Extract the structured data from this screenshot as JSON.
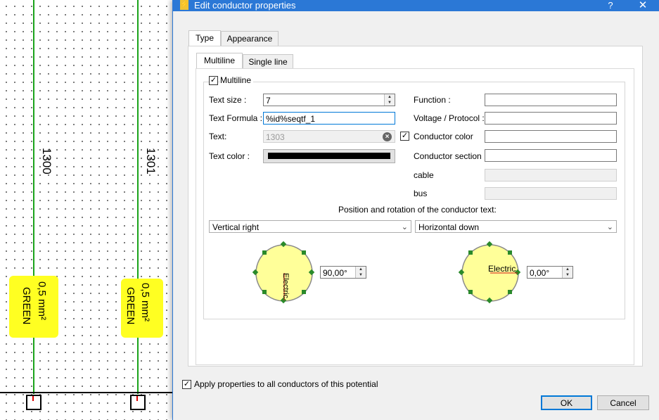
{
  "canvas": {
    "wires": [
      {
        "number": "1300",
        "section": "0,5 mm²",
        "color": "GREEN"
      },
      {
        "number": "1301",
        "section": "0,5 mm²",
        "color": "GREEN"
      }
    ],
    "wire_color": "#1aa31a",
    "highlight_color": "#ffff22"
  },
  "dialog": {
    "title": "Edit conductor properties",
    "help_label": "?",
    "close_label": "✕",
    "app_icon_glyph": "⚡",
    "tabs": [
      "Type",
      "Appearance"
    ],
    "subtabs": [
      "Multiline",
      "Single line"
    ],
    "multiline_group": {
      "checkbox_label": "Multiline",
      "text_size_label": "Text size :",
      "text_size_value": "7",
      "text_formula_label": "Text Formula :",
      "text_formula_value": "%id%seqtf_1",
      "text_label": "Text:",
      "text_value": "1303",
      "text_color_label": "Text color :",
      "function_label": "Function :",
      "voltage_label": "Voltage / Protocol :",
      "conductor_color_label": "Conductor color",
      "conductor_section_label": "Conductor section",
      "cable_label": "cable",
      "bus_label": "bus",
      "position_label": "Position and rotation of the conductor text:",
      "vertical_select": "Vertical right",
      "horizontal_select": "Horizontal down",
      "vertical_angle": "90,00°",
      "horizontal_angle": "0,00°",
      "preview_text": "Electric"
    },
    "apply_all_label": "Apply properties to all conductors of this potential",
    "ok_label": "OK",
    "cancel_label": "Cancel",
    "accent_color": "#0078d7",
    "title_bar_color": "#2b78d6"
  }
}
